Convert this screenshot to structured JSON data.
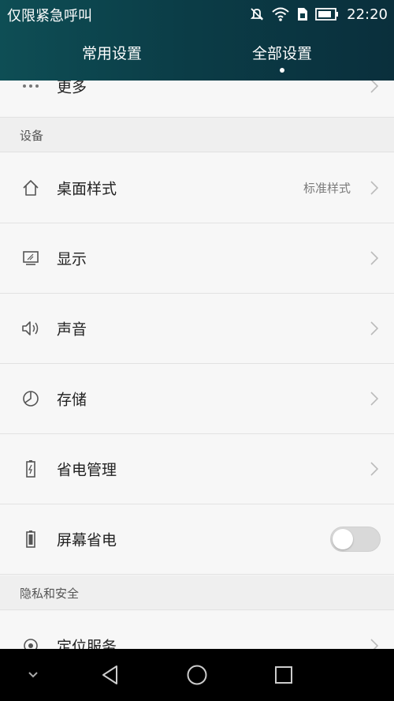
{
  "status_bar": {
    "carrier": "仅限紧急呼叫",
    "time": "22:20",
    "icons": [
      "mute-icon",
      "wifi-icon",
      "sim-icon",
      "battery-icon"
    ]
  },
  "tabs": [
    {
      "label": "常用设置",
      "active": false
    },
    {
      "label": "全部设置",
      "active": true
    }
  ],
  "rows": {
    "more": {
      "label": "更多",
      "icon": "more-dots-icon"
    },
    "desktop": {
      "label": "桌面样式",
      "value": "标准样式",
      "icon": "home-icon"
    },
    "display": {
      "label": "显示",
      "icon": "display-icon"
    },
    "sound": {
      "label": "声音",
      "icon": "speaker-icon"
    },
    "storage": {
      "label": "存储",
      "icon": "storage-pie-icon"
    },
    "power": {
      "label": "省电管理",
      "icon": "battery-power-icon"
    },
    "screen_saver": {
      "label": "屏幕省电",
      "icon": "battery-screen-icon",
      "toggle_on": false
    },
    "location": {
      "label": "定位服务",
      "icon": "location-icon"
    }
  },
  "sections": {
    "device": "设备",
    "privacy": "隐私和安全"
  },
  "navbar": {
    "icons": [
      "collapse-chevron-icon",
      "back-icon",
      "home-circle-icon",
      "recent-apps-icon"
    ]
  },
  "colors": {
    "header_bg": "#0b3d47",
    "row_bg": "#f7f7f7",
    "section_bg": "#efefef",
    "text": "#222222",
    "secondary_text": "#7a7a7a",
    "navbar_bg": "#000000"
  }
}
